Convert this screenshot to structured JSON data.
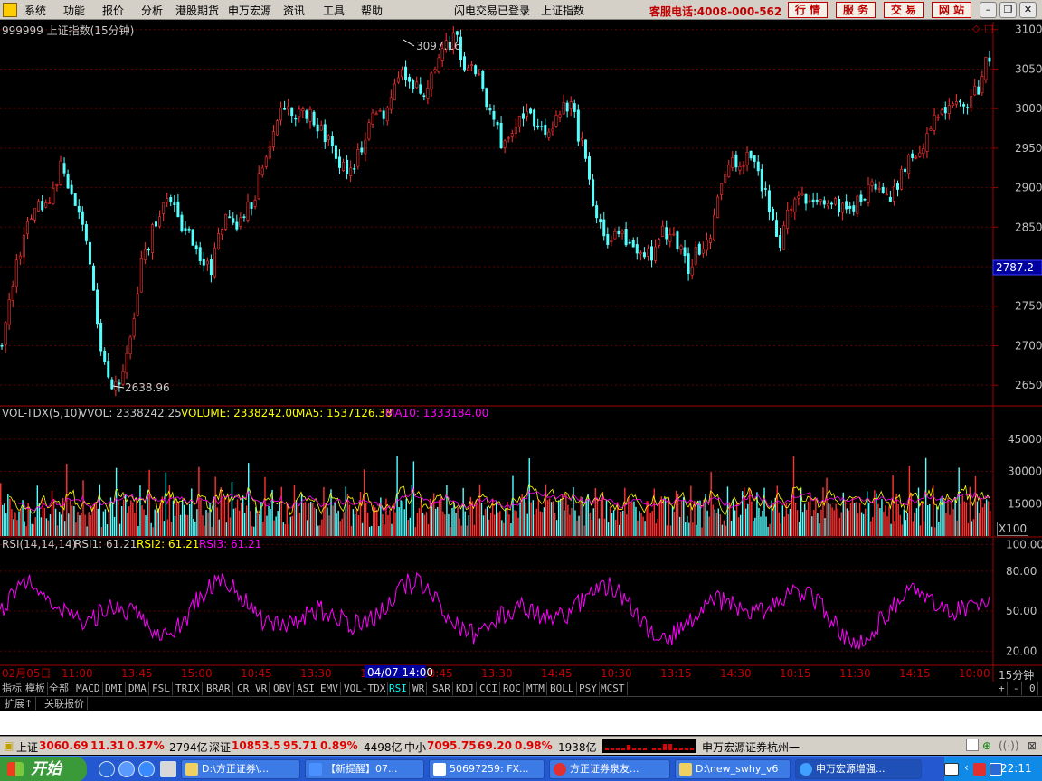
{
  "menu": {
    "items": [
      "系统",
      "功能",
      "报价",
      "分析",
      "港股期货",
      "申万宏源",
      "资讯",
      "工具",
      "帮助"
    ],
    "status1": "闪电交易已登录",
    "status2": "上证指数",
    "hotline": "客服电话:4008-000-562",
    "buttons": [
      "行 情",
      "服 务",
      "交 易",
      "网 站"
    ]
  },
  "chart": {
    "title": "999999 上证指数(15分钟)",
    "high_label": "3097.16",
    "low_label": "2638.96",
    "current_price": "2787.2",
    "price_ticks": [
      "3100",
      "3050",
      "3000",
      "2950",
      "2900",
      "2850",
      "2800",
      "2750",
      "2700",
      "2650"
    ],
    "volume_info": {
      "name": "VOL-TDX(5,10)",
      "vvol": "VVOL: 2338242.25",
      "volume": "VOLUME: 2338242.00",
      "ma5": "MA5: 1537126.38",
      "ma10": "MA10: 1333184.00"
    },
    "volume_ticks": [
      "45000",
      "30000",
      "15000"
    ],
    "volume_unit": "X100",
    "rsi_info": {
      "name": "RSI(14,14,14)",
      "rsi1": "RSI1: 61.21",
      "rsi2": "RSI2: 61.21",
      "rsi3": "RSI3: 61.21"
    },
    "rsi_ticks": [
      "100.00",
      "80.00",
      "50.00",
      "20.00"
    ],
    "time_labels": [
      "02月05日",
      "11:00",
      "13:45",
      "15:00",
      "10:45",
      "13:30",
      "14:00",
      "10:45",
      "13:30",
      "14:45",
      "10:30",
      "13:15",
      "14:30",
      "10:15",
      "11:30",
      "14:15",
      "10:00"
    ],
    "cursor_label": "04/07 14:00",
    "period": "15分钟"
  },
  "chart_data": {
    "type": "candlestick",
    "ylim": [
      2625,
      3110
    ],
    "high": 3097.16,
    "low": 2638.96,
    "last": 2787.2,
    "close_path": [
      2700,
      2780,
      2850,
      2880,
      2870,
      2930,
      2900,
      2860,
      2750,
      2660,
      2640,
      2700,
      2800,
      2850,
      2890,
      2870,
      2840,
      2810,
      2800,
      2860,
      2850,
      2870,
      2900,
      2960,
      3010,
      2990,
      3000,
      2980,
      2960,
      2930,
      2920,
      2950,
      3000,
      2990,
      3050,
      3040,
      3020,
      3040,
      3080,
      3090,
      3050,
      3040,
      2990,
      2960,
      2970,
      2990,
      2980,
      2970,
      3000,
      3000,
      2950,
      2870,
      2830,
      2840,
      2830,
      2820,
      2810,
      2850,
      2830,
      2800,
      2820,
      2840,
      2910,
      2930,
      2940,
      2920,
      2880,
      2830,
      2880,
      2890,
      2880,
      2890,
      2880,
      2870,
      2890,
      2900,
      2880,
      2900,
      2930,
      2950,
      2980,
      3000,
      3020,
      3010,
      3020,
      3070
    ]
  },
  "tabs": [
    "指标",
    "模板",
    "全部",
    "MACD",
    "DMI",
    "DMA",
    "FSL",
    "TRIX",
    "BRAR",
    "CR",
    "VR",
    "OBV",
    "ASI",
    "EMV",
    "VOL-TDX",
    "RSI",
    "WR",
    "SAR",
    "KDJ",
    "CCI",
    "ROC",
    "MTM",
    "BOLL",
    "PSY",
    "MCST"
  ],
  "tabs_right": [
    "+",
    "-",
    "0"
  ],
  "tabs2": [
    "扩展↑",
    "关联报价"
  ],
  "ticker": {
    "sh_name": "上证",
    "sh_price": "3060.69",
    "sh_change": "11.31",
    "sh_pct": "0.37%",
    "sh_amount": "2794亿",
    "sz_name": "深证",
    "sz_price": "10853.5",
    "sz_change": "95.71",
    "sz_pct": "0.89%",
    "sz_amount": "4498亿",
    "zx_name": "中小",
    "zx_price": "7095.75",
    "zx_change": "69.20",
    "zx_pct": "0.98%",
    "zx_amount": "1938亿",
    "broker": "申万宏源证券杭州一"
  },
  "taskbar": {
    "start": "开始",
    "tasks": [
      "D:\\方正证券\\...",
      "【新提醒】07...",
      "50697259: FX...",
      "方正证券泉友...",
      "D:\\new_swhy_v6",
      "申万宏源增强..."
    ],
    "clock": "22:11"
  }
}
